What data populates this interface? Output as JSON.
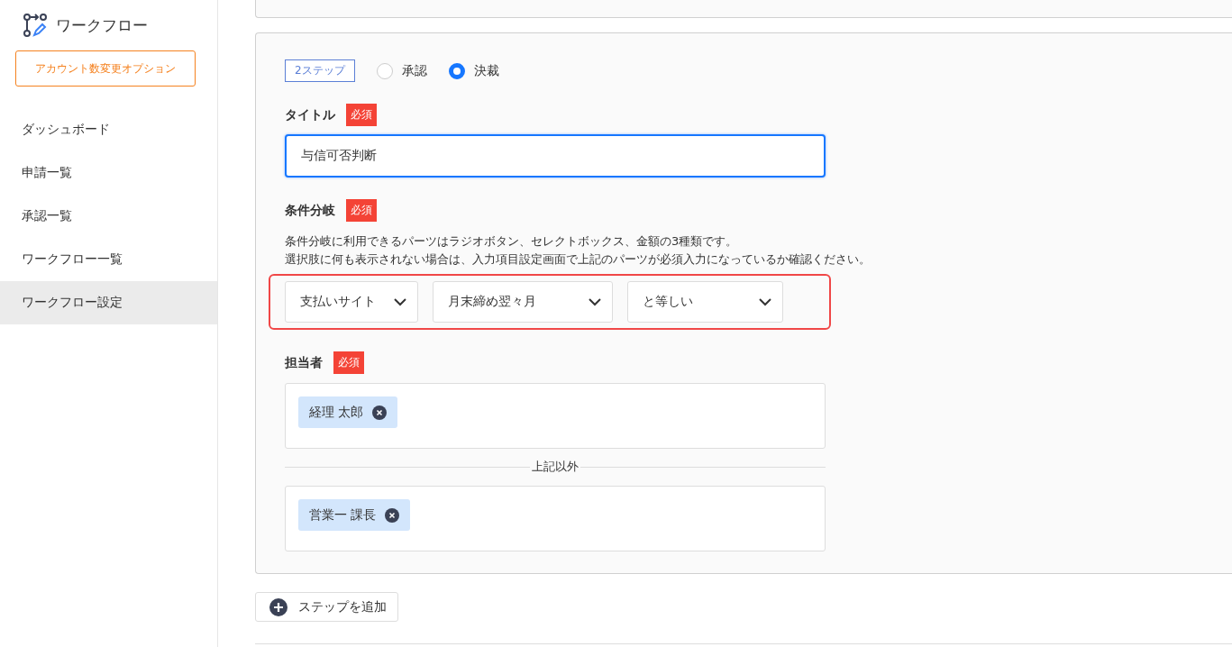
{
  "sidebar": {
    "title": "ワークフロー",
    "option_button": "アカウント数変更オプション",
    "items": [
      {
        "label": "ダッシュボード",
        "selected": false
      },
      {
        "label": "申請一覧",
        "selected": false
      },
      {
        "label": "承認一覧",
        "selected": false
      },
      {
        "label": "ワークフロー一覧",
        "selected": false
      },
      {
        "label": "ワークフロー設定",
        "selected": true
      }
    ]
  },
  "step": {
    "badge": "2ステップ",
    "modes": [
      {
        "label": "承認",
        "selected": false
      },
      {
        "label": "決裁",
        "selected": true
      }
    ],
    "title_field": {
      "label": "タイトル",
      "required": "必須",
      "value": "与信可否判断"
    },
    "condition": {
      "label": "条件分岐",
      "required": "必須",
      "help": [
        "条件分岐に利用できるパーツはラジオボタン、セレクトボックス、金額の3種類です。",
        "選択肢に何も表示されない場合は、入力項目設定画面で上記のパーツが必須入力になっているか確認ください。"
      ],
      "selects": [
        {
          "value": "支払いサイト"
        },
        {
          "value": "月末締め翌々月"
        },
        {
          "value": "と等しい"
        }
      ]
    },
    "assignee": {
      "label": "担当者",
      "required": "必須",
      "groups": [
        {
          "tags": [
            "経理 太郎"
          ]
        },
        {
          "divider": "上記以外",
          "tags": [
            "営業一 課長"
          ]
        }
      ]
    }
  },
  "add_step_button": "ステップを追加"
}
